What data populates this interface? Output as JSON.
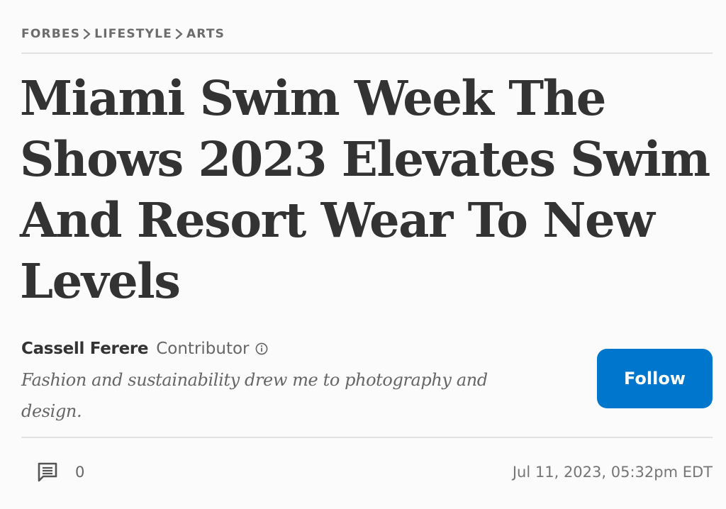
{
  "breadcrumb": {
    "items": [
      "FORBES",
      "LIFESTYLE",
      "ARTS"
    ]
  },
  "article": {
    "headline": "Miami Swim Week The Shows 2023 Elevates Swim And Resort Wear To New Levels"
  },
  "author": {
    "name": "Cassell Ferere",
    "role": "Contributor",
    "info_icon": "info-circle-icon",
    "bio": "Fashion and sustainability drew me to photography and design.",
    "follow_label": "Follow"
  },
  "meta": {
    "comment_icon": "comment-icon",
    "comment_count": "0",
    "timestamp": "Jul 11, 2023, 05:32pm EDT"
  },
  "colors": {
    "background": "#fbfbfb",
    "headline_text": "#333333",
    "muted_text": "#666666",
    "follow_button": "#0077cc",
    "divider": "#e2e2e2"
  }
}
